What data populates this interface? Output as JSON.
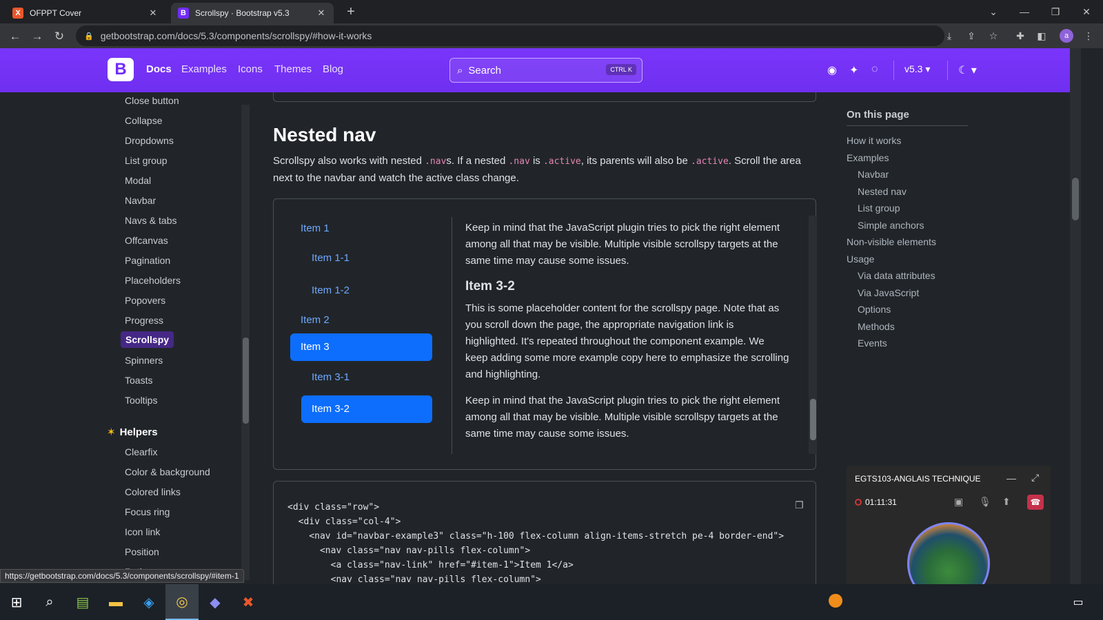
{
  "browser": {
    "tabs": [
      {
        "title": "OFPPT Cover",
        "favicon": "X",
        "color": "#e8572b"
      },
      {
        "title": "Scrollspy · Bootstrap v5.3",
        "favicon": "B",
        "color": "#712cf9"
      }
    ],
    "url": "getbootstrap.com/docs/5.3/components/scrollspy/#how-it-works",
    "profile_initial": "a"
  },
  "bsnav": {
    "links": [
      "Docs",
      "Examples",
      "Icons",
      "Themes",
      "Blog"
    ],
    "search_placeholder": "Search",
    "search_kbd": "CTRL K",
    "version": "v5.3"
  },
  "sidebar": {
    "components": [
      "Close button",
      "Collapse",
      "Dropdowns",
      "List group",
      "Modal",
      "Navbar",
      "Navs & tabs",
      "Offcanvas",
      "Pagination",
      "Placeholders",
      "Popovers",
      "Progress",
      "Scrollspy",
      "Spinners",
      "Toasts",
      "Tooltips"
    ],
    "active": "Scrollspy",
    "helpers_heading": "Helpers",
    "helpers": [
      "Clearfix",
      "Color & background",
      "Colored links",
      "Focus ring",
      "Icon link",
      "Position",
      "Ratio"
    ]
  },
  "main": {
    "section_title": "Nested nav",
    "lead_parts": [
      "Scrollspy also works with nested ",
      ".nav",
      "s. If a nested ",
      ".nav",
      " is ",
      ".active",
      ", its parents will also be ",
      ".active",
      ". Scroll the area next to the navbar and watch the active class change."
    ],
    "pills": [
      "Item 1",
      "Item 1-1",
      "Item 1-2",
      "Item 2",
      "Item 3",
      "Item 3-1",
      "Item 3-2"
    ],
    "para_a": "Keep in mind that the JavaScript plugin tries to pick the right element among all that may be visible. Multiple visible scrollspy targets at the same time may cause some issues.",
    "heading_32": "Item 3-2",
    "para_b": "This is some placeholder content for the scrollspy page. Note that as you scroll down the page, the appropriate navigation link is highlighted. It's repeated throughout the component example. We keep adding some more example copy here to emphasize the scrolling and highlighting.",
    "para_c": "Keep in mind that the JavaScript plugin tries to pick the right element among all that may be visible. Multiple visible scrollspy targets at the same time may cause some issues.",
    "code_lines": [
      "<div class=\"row\">",
      "  <div class=\"col-4\">",
      "    <nav id=\"navbar-example3\" class=\"h-100 flex-column align-items-stretch pe-4 border-end\">",
      "      <nav class=\"nav nav-pills flex-column\">",
      "        <a class=\"nav-link\" href=\"#item-1\">Item 1</a>",
      "        <nav class=\"nav nav-pills flex-column\">"
    ]
  },
  "toc": {
    "heading": "On this page",
    "items": [
      "How it works",
      "Examples",
      "Navbar",
      "Nested nav",
      "List group",
      "Simple anchors",
      "Non-visible elements",
      "Usage",
      "Via data attributes",
      "Via JavaScript",
      "Options",
      "Methods",
      "Events"
    ]
  },
  "call": {
    "title": "EGTS103-ANGLAIS TECHNIQUE",
    "timer": "01:11:31"
  },
  "status_url": "https://getbootstrap.com/docs/5.3/components/scrollspy/#item-1"
}
